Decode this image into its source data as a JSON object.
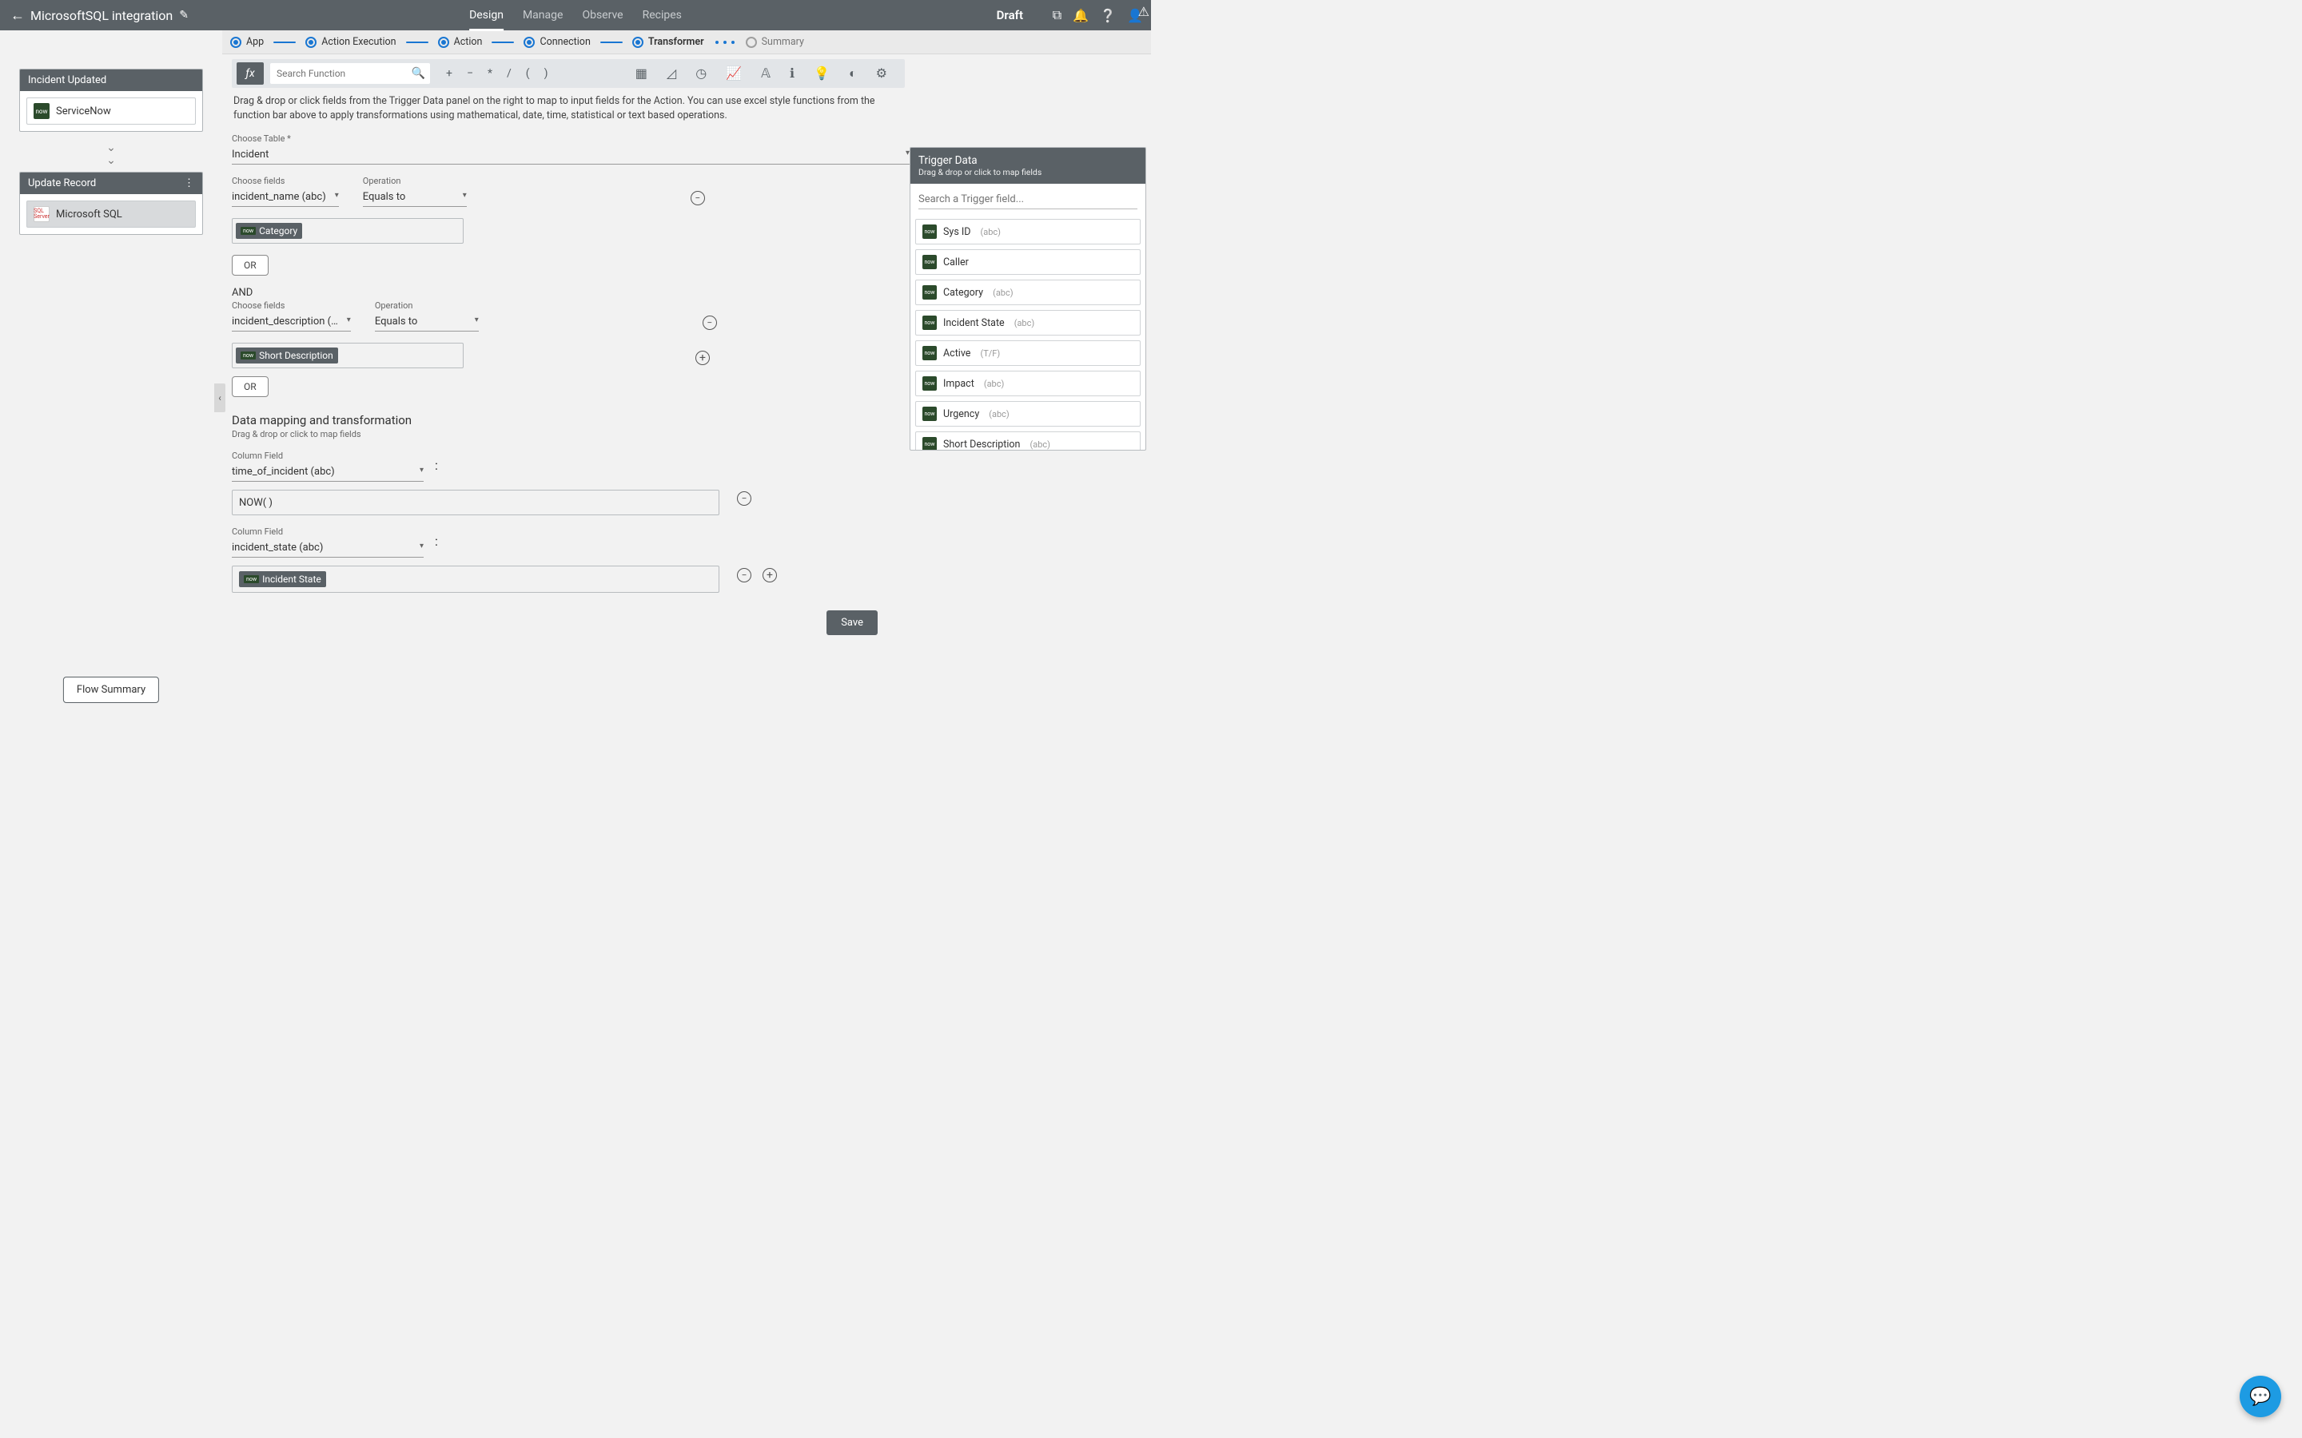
{
  "header": {
    "title": "MicrosoftSQL integration",
    "tabs": [
      "Design",
      "Manage",
      "Observe",
      "Recipes"
    ],
    "active_tab": "Design",
    "status": "Draft"
  },
  "stepper": {
    "steps": [
      {
        "label": "App",
        "state": "done"
      },
      {
        "label": "Action Execution",
        "state": "done"
      },
      {
        "label": "Action",
        "state": "done"
      },
      {
        "label": "Connection",
        "state": "done"
      },
      {
        "label": "Transformer",
        "state": "active"
      },
      {
        "label": "Summary",
        "state": "pending"
      }
    ]
  },
  "sidebar": {
    "card1_title": "Incident Updated",
    "card1_node": "ServiceNow",
    "card2_title": "Update Record",
    "card2_node": "Microsoft SQL",
    "flow_summary": "Flow Summary"
  },
  "funcbar": {
    "search_placeholder": "Search Function",
    "ops": [
      "+",
      "−",
      "*",
      "/",
      "(",
      ")"
    ]
  },
  "help_text": "Drag & drop or click fields from the Trigger Data panel on the right to map to input fields for the Action. You can use excel style functions from the function bar above to apply transformations using mathematical, date, time, statistical or text based operations.",
  "form": {
    "choose_table_label": "Choose Table *",
    "choose_table_value": "Incident",
    "cond1": {
      "choose_fields_label": "Choose fields",
      "field_value": "incident_name (abc)",
      "operation_label": "Operation",
      "operation_value": "Equals to",
      "chip_label": "Category"
    },
    "or_label": "OR",
    "and_label": "AND",
    "cond2": {
      "choose_fields_label": "Choose fields",
      "field_value": "incident_description (…",
      "operation_label": "Operation",
      "operation_value": "Equals to",
      "chip_label": "Short Description"
    },
    "mapping_title": "Data mapping and transformation",
    "mapping_help": "Drag & drop or click to map fields",
    "map1": {
      "column_label": "Column Field",
      "column_value": "time_of_incident (abc)",
      "value_text": "NOW( )"
    },
    "map2": {
      "column_label": "Column Field",
      "column_value": "incident_state (abc)",
      "chip_label": "Incident State"
    },
    "save_label": "Save"
  },
  "trigger_panel": {
    "title": "Trigger Data",
    "sub": "Drag & drop or click to map fields",
    "search_placeholder": "Search a Trigger field...",
    "items": [
      {
        "label": "Sys ID",
        "type": "(abc)"
      },
      {
        "label": "Caller",
        "type": ""
      },
      {
        "label": "Category",
        "type": "(abc)"
      },
      {
        "label": "Incident State",
        "type": "(abc)"
      },
      {
        "label": "Active",
        "type": "(T/F)"
      },
      {
        "label": "Impact",
        "type": "(abc)"
      },
      {
        "label": "Urgency",
        "type": "(abc)"
      },
      {
        "label": "Short Description",
        "type": "(abc)"
      }
    ]
  }
}
